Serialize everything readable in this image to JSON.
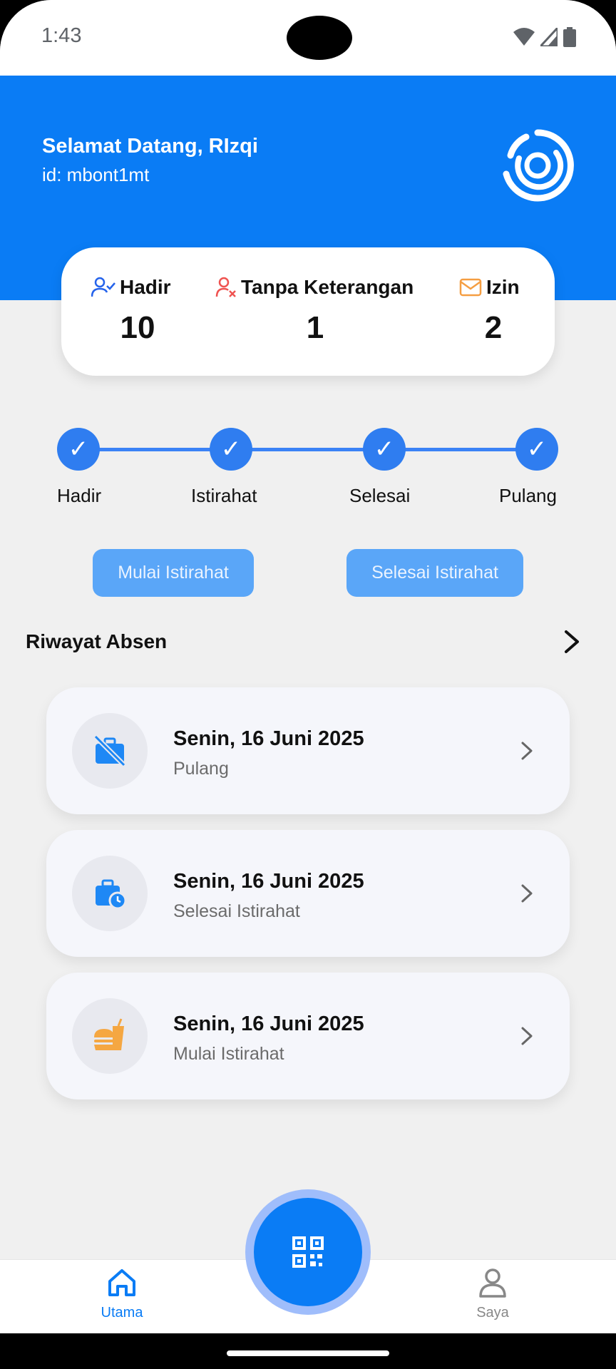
{
  "status_bar": {
    "time": "1:43"
  },
  "header": {
    "greeting": "Selamat Datang, RIzqi",
    "user_id": "id: mbont1mt",
    "accent_color": "#0a7cf5"
  },
  "stats": {
    "hadir": {
      "label": "Hadir",
      "value": "10",
      "icon": "user-check-icon"
    },
    "tanpa_keterangan": {
      "label": "Tanpa Keterangan",
      "value": "1",
      "icon": "user-x-icon"
    },
    "izin": {
      "label": "Izin",
      "value": "2",
      "icon": "mail-icon"
    }
  },
  "stepper": {
    "steps": [
      {
        "label": "Hadir",
        "done": true
      },
      {
        "label": "Istirahat",
        "done": true
      },
      {
        "label": "Selesai",
        "done": true
      },
      {
        "label": "Pulang",
        "done": true
      }
    ],
    "check_glyph": "✓"
  },
  "actions": {
    "start_break": "Mulai Istirahat",
    "end_break": "Selesai Istirahat"
  },
  "history": {
    "title": "Riwayat Absen",
    "items": [
      {
        "date": "Senin, 16 Juni 2025",
        "status": "Pulang",
        "icon": "briefcase-off-icon"
      },
      {
        "date": "Senin, 16 Juni 2025",
        "status": "Selesai Istirahat",
        "icon": "briefcase-clock-icon"
      },
      {
        "date": "Senin, 16 Juni 2025",
        "status": "Mulai Istirahat",
        "icon": "fastfood-icon"
      }
    ]
  },
  "bottom_nav": {
    "home": {
      "label": "Utama",
      "active": true
    },
    "profile": {
      "label": "Saya",
      "active": false
    },
    "scan_icon": "qr-code-icon"
  }
}
